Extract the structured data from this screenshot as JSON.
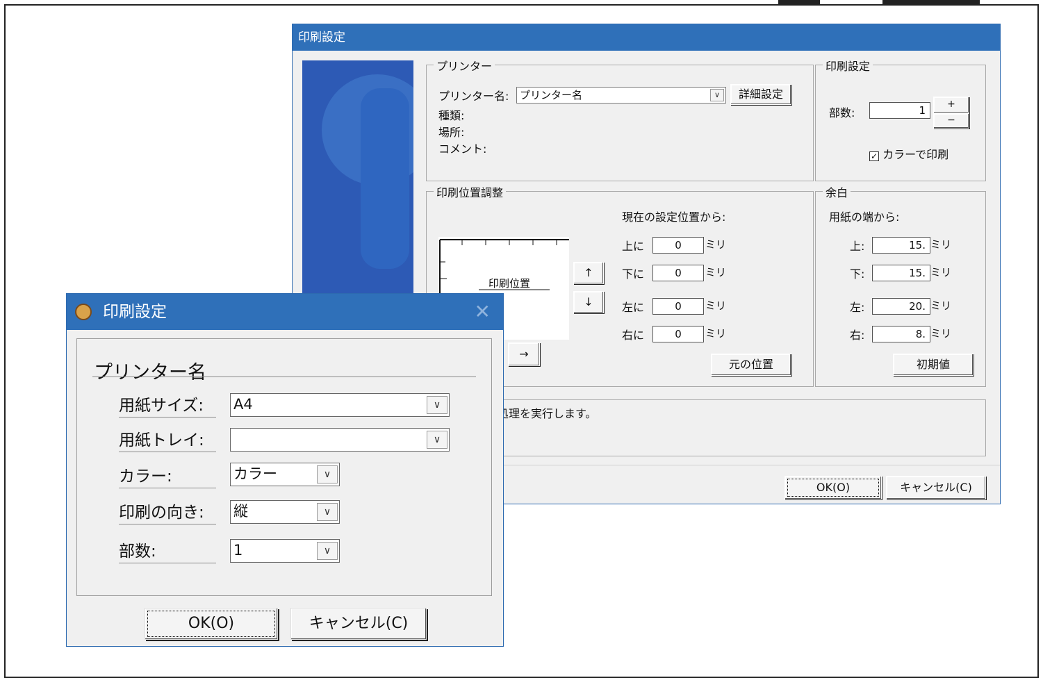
{
  "back_dialog": {
    "title": "印刷設定",
    "printer_group": {
      "legend": "プリンター",
      "name_label": "プリンター名:",
      "name_value": "プリンター名",
      "detail_button": "詳細設定",
      "type_label": "種類:",
      "location_label": "場所:",
      "comment_label": "コメント:"
    },
    "print_settings_group": {
      "legend": "印刷設定",
      "copies_label": "部数:",
      "copies_value": "1",
      "plus": "+",
      "minus": "−",
      "color_checkbox_label": "カラーで印刷",
      "color_checked": true
    },
    "position_group": {
      "legend": "印刷位置調整",
      "from_current": "現在の設定位置から:",
      "preview_label": "印刷位置",
      "up_arrow": "↑",
      "down_arrow": "↓",
      "right_arrow": "→",
      "rows": [
        {
          "label": "上に",
          "value": "0",
          "unit": "ミリ"
        },
        {
          "label": "下に",
          "value": "0",
          "unit": "ミリ"
        },
        {
          "label": "左に",
          "value": "0",
          "unit": "ミリ"
        },
        {
          "label": "右に",
          "value": "0",
          "unit": "ミリ"
        }
      ],
      "reset_button": "元の位置"
    },
    "margin_group": {
      "legend": "余白",
      "from_edge": "用紙の端から:",
      "rows": [
        {
          "label": "上:",
          "value": "15.",
          "unit": "ミリ"
        },
        {
          "label": "下:",
          "value": "15.",
          "unit": "ミリ"
        },
        {
          "label": "左:",
          "value": "20.",
          "unit": "ミリ"
        },
        {
          "label": "右:",
          "value": "8.",
          "unit": "ミリ"
        }
      ],
      "default_button": "初期値"
    },
    "message": "処理を実行します。",
    "ok_button": "OK(O)",
    "cancel_button": "キャンセル(C)"
  },
  "front_dialog": {
    "title": "印刷設定",
    "heading": "プリンター名",
    "rows": [
      {
        "label": "用紙サイズ:",
        "value": "A4"
      },
      {
        "label": "用紙トレイ:",
        "value": ""
      },
      {
        "label": "カラー:",
        "value": "カラー"
      },
      {
        "label": "印刷の向き:",
        "value": "縦"
      },
      {
        "label": "部数:",
        "value": "1"
      }
    ],
    "ok_button": "OK(O)",
    "cancel_button": "キャンセル(C)",
    "close_glyph": "✕"
  },
  "icons": {
    "dropdown": "chevron-down-icon",
    "app": "app-icon"
  }
}
